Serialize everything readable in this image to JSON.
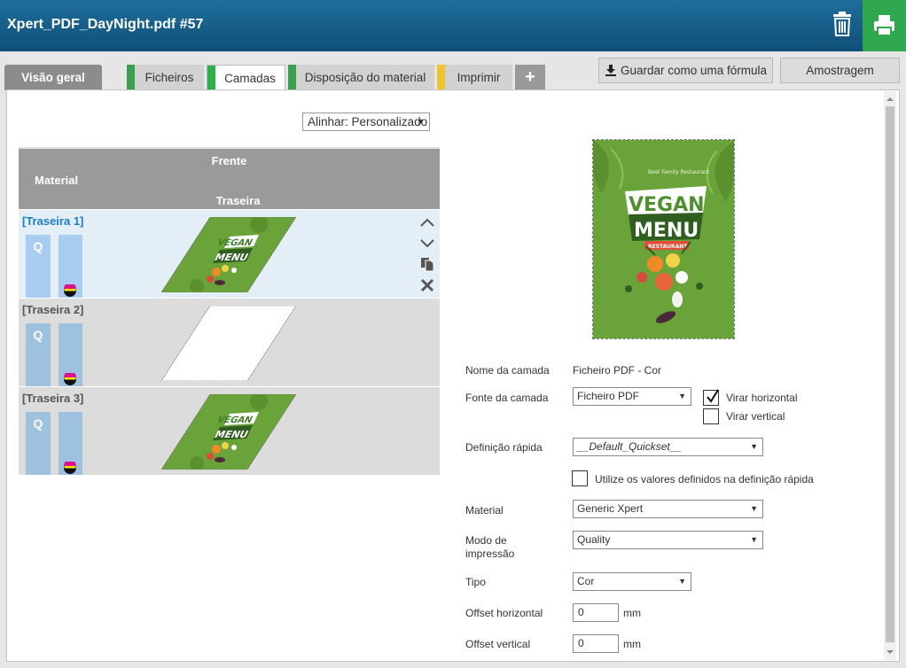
{
  "header": {
    "title": "Xpert_PDF_DayNight.pdf #57"
  },
  "tabs": [
    {
      "label": "Visão geral",
      "marker": ""
    },
    {
      "label": "Ficheiros",
      "marker": "#3aa050"
    },
    {
      "label": "Camadas",
      "marker": "#2fb04a"
    },
    {
      "label": "Disposição do material",
      "marker": "#3aa050"
    },
    {
      "label": "Imprimir",
      "marker": "#f0c330"
    },
    {
      "label": "+"
    }
  ],
  "toolbar": {
    "save_formula_label": "Guardar como uma fórmula",
    "sampling_label": "Amostragem"
  },
  "align": {
    "value": "Alinhar: Personalizado"
  },
  "layer_table": {
    "head_front": "Frente",
    "head_material": "Material",
    "head_back": "Traseira",
    "rows": [
      {
        "name": "[Traseira 1]",
        "quality": "Q",
        "thumb": "vegan-menu"
      },
      {
        "name": "[Traseira 2]",
        "quality": "Q",
        "thumb": "blank"
      },
      {
        "name": "[Traseira 3]",
        "quality": "Q",
        "thumb": "vegan-menu"
      }
    ]
  },
  "preview": {
    "small_text": "Best Family Restaurant",
    "vegan": "VEGAN",
    "menu": "MENU",
    "ribbon": "RESTAURANT"
  },
  "form": {
    "layer_name_label": "Nome da camada",
    "layer_name_value": "Ficheiro PDF - Cor",
    "layer_source_label": "Fonte da camada",
    "layer_source_value": "Ficheiro PDF",
    "flip_horizontal_label": "Virar horizontal",
    "flip_vertical_label": "Virar vertical",
    "flip_horizontal_checked": true,
    "flip_vertical_checked": false,
    "quickset_label": "Definição rápida",
    "quickset_value": "__Default_Quickset__",
    "use_quickset_label": "Utilize os valores definidos na definição rápida",
    "material_label": "Material",
    "material_value": "Generic Xpert",
    "print_mode_label_1": "Modo de",
    "print_mode_label_2": "impressão",
    "print_mode_value": "Quality",
    "type_label": "Tipo",
    "type_value": "Cor",
    "offset_h_label": "Offset horizontal",
    "offset_h_value": "0",
    "offset_v_label": "Offset vertical",
    "offset_v_value": "0",
    "unit": "mm"
  },
  "colors": {
    "header": "#0e4f78",
    "print": "#2fa84f",
    "selected_row": "#e3eef7",
    "accent_blue": "#1a7dc4",
    "menu_green": "#6aa33a"
  }
}
